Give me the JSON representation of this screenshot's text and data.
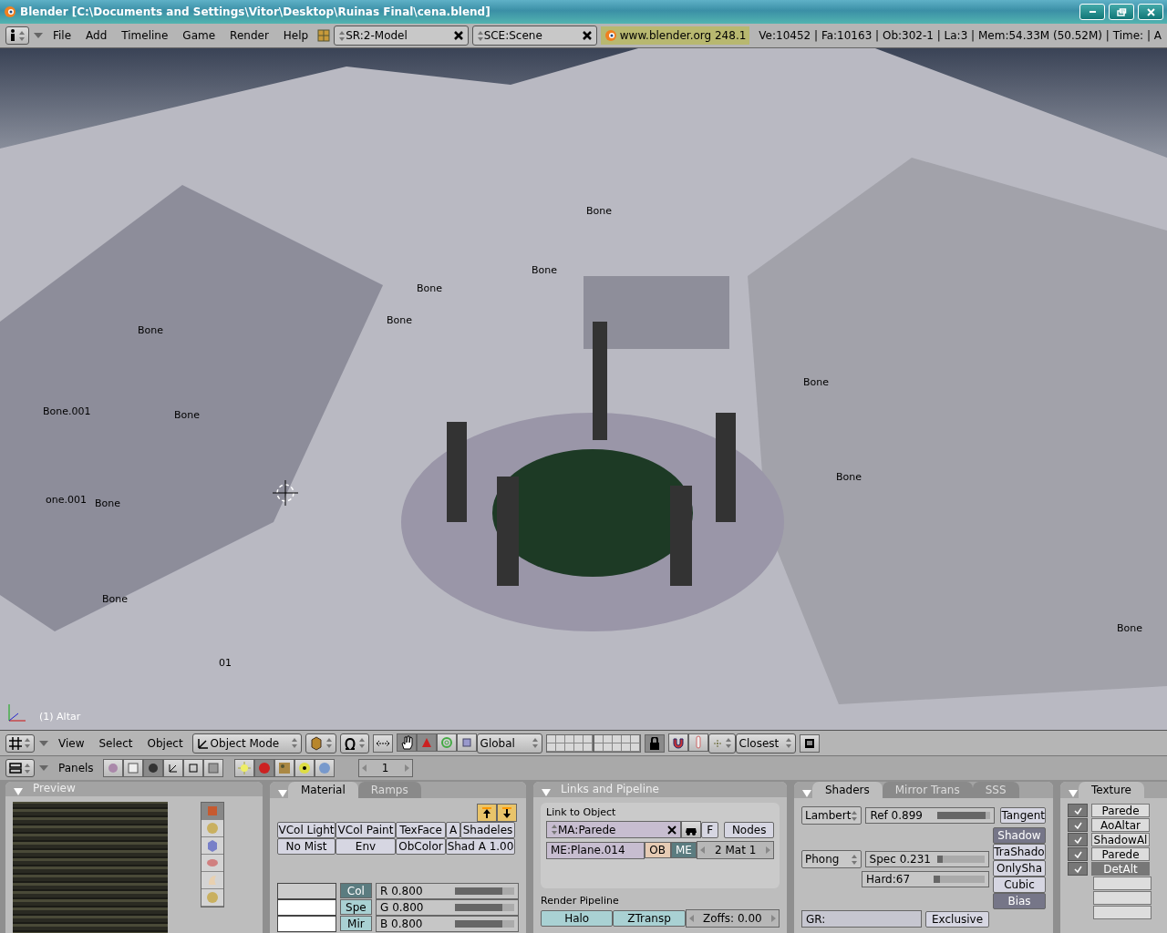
{
  "window": {
    "title": "Blender [C:\\Documents and Settings\\Vitor\\Desktop\\Ruinas Final\\cena.blend]"
  },
  "info_header": {
    "menus": [
      "File",
      "Add",
      "Timeline",
      "Game",
      "Render",
      "Help"
    ],
    "screen": "SR:2-Model",
    "scene": "SCE:Scene",
    "version": "www.blender.org 248.1",
    "stats": "Ve:10452 | Fa:10163 | Ob:302-1 | La:3  | Mem:54.33M (50.52M)  | Time: | A"
  },
  "viewport": {
    "object_label": "(1) Altar",
    "bone_labels": [
      "Bone",
      "Bone",
      "Bone",
      "Bone",
      "Bone",
      "Bone.001",
      "Bone",
      "one.001",
      "Bone",
      "Bone",
      "01",
      "Bone",
      "Bone",
      "Bone"
    ]
  },
  "view3d_header": {
    "menus": [
      "View",
      "Select",
      "Object"
    ],
    "mode": "Object Mode",
    "orientation": "Global",
    "snap_target": "Closest"
  },
  "buttons_header": {
    "menu": "Panels",
    "frame": "1"
  },
  "preview": {
    "title": "Preview",
    "shapes": [
      {
        "selected": true
      },
      {
        "selected": false
      },
      {
        "selected": false
      },
      {
        "selected": false
      },
      {
        "selected": false
      },
      {
        "selected": false
      }
    ]
  },
  "material": {
    "tabs": [
      {
        "label": "Material",
        "selected": true
      },
      {
        "label": "Ramps",
        "selected": false
      }
    ],
    "toggles": [
      {
        "label": "VCol Light",
        "on": false
      },
      {
        "label": "VCol Paint",
        "on": false
      },
      {
        "label": "TexFace",
        "on": false
      },
      {
        "label": "A",
        "on": false
      },
      {
        "label": "Shadeles",
        "on": false
      },
      {
        "label": "No Mist",
        "on": false
      },
      {
        "label": "Env",
        "on": false
      },
      {
        "label": "ObColor",
        "on": false
      },
      {
        "label": "Shad A 1.00",
        "on": false
      }
    ],
    "swatches": [
      {
        "color": "#cccccc"
      },
      {
        "color": "#ffffff"
      },
      {
        "color": "#ffffff"
      }
    ],
    "color_modes": [
      {
        "label": "Col",
        "selected": true
      },
      {
        "label": "Spe",
        "selected": false
      },
      {
        "label": "Mir",
        "selected": false
      }
    ],
    "sliders": [
      {
        "label": "R 0.800",
        "level": 0.8
      },
      {
        "label": "G 0.800",
        "level": 0.8
      },
      {
        "label": "B 0.800",
        "level": 0.8
      }
    ]
  },
  "links": {
    "title": "Links and Pipeline",
    "link_label": "Link to Object",
    "material": "MA:Parede",
    "fake": "F",
    "nodes": "Nodes",
    "mesh": "ME:Plane.014",
    "link_to": [
      {
        "label": "OB",
        "selected": false
      },
      {
        "label": "ME",
        "selected": true
      }
    ],
    "mat_index": "2 Mat 1",
    "pipeline_label": "Render Pipeline",
    "halo": "Halo",
    "ztransp": "ZTransp",
    "zoffs": "Zoffs: 0.00"
  },
  "shaders": {
    "tabs": [
      {
        "label": "Shaders",
        "selected": true
      },
      {
        "label": "Mirror Trans",
        "selected": false
      },
      {
        "label": "SSS",
        "selected": false
      }
    ],
    "diffuse": "Lambert",
    "ref": {
      "label": "Ref   0.899",
      "level": 0.899
    },
    "tangent": "Tangent",
    "specular": "Phong",
    "spec": {
      "label": "Spec 0.231",
      "level": 0.115
    },
    "hard": {
      "label": "Hard:67",
      "level": 0.13
    },
    "toggles": [
      {
        "label": "Shadow",
        "on": true
      },
      {
        "label": "TraShado",
        "on": false
      },
      {
        "label": "OnlySha",
        "on": false
      },
      {
        "label": "Cubic",
        "on": false
      },
      {
        "label": "Bias",
        "on": true
      }
    ],
    "group": "GR:",
    "exclusive": "Exclusive"
  },
  "texture": {
    "tabs": [
      {
        "label": "Texture",
        "selected": true
      }
    ],
    "channels": [
      {
        "name": "Parede",
        "checked": true,
        "selected": false
      },
      {
        "name": "AoAltar",
        "checked": true,
        "selected": false
      },
      {
        "name": "ShadowAl",
        "checked": true,
        "selected": false
      },
      {
        "name": "Parede",
        "checked": true,
        "selected": false
      },
      {
        "name": "DetAlt",
        "checked": true,
        "selected": true
      }
    ]
  }
}
